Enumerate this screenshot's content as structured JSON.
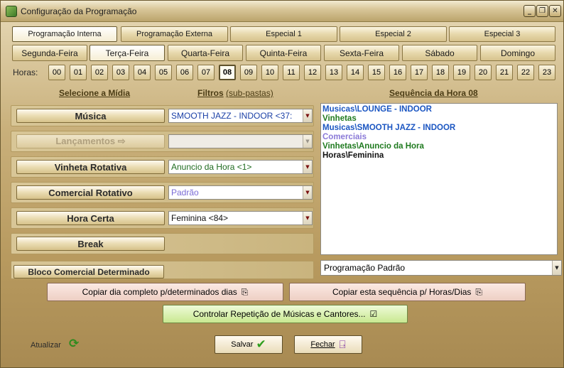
{
  "window": {
    "title": "Configuração da Programação"
  },
  "titlebar": {
    "minimize": "_",
    "restore": "❐",
    "close": "✕"
  },
  "prog_tabs": [
    "Programação Interna",
    "Programação Externa",
    "Especial 1",
    "Especial  2",
    "Especial  3"
  ],
  "day_tabs": [
    "Segunda-Feira",
    "Terça-Feira",
    "Quarta-Feira",
    "Quinta-Feira",
    "Sexta-Feira",
    "Sábado",
    "Domingo"
  ],
  "hours_label": "Horas:",
  "hours": [
    "00",
    "01",
    "02",
    "03",
    "04",
    "05",
    "06",
    "07",
    "08",
    "09",
    "10",
    "11",
    "12",
    "13",
    "14",
    "15",
    "16",
    "17",
    "18",
    "19",
    "20",
    "21",
    "22",
    "23"
  ],
  "selected_hour": "08",
  "headers": {
    "media": "Selecione a Mídia",
    "filters_a": "Filtros",
    "filters_b": "(sub-pastas)",
    "sequence": "Sequência da Hora 08"
  },
  "media_rows": [
    {
      "button": "Música",
      "combo": "SMOOTH JAZZ - INDOOR <37:",
      "combo_color": "#1a3fa6",
      "enabled": true
    },
    {
      "button": "Lançamentos ⇨",
      "combo": "",
      "combo_color": "#000000",
      "enabled": false
    },
    {
      "button": "Vinheta Rotativa",
      "combo": "Anuncio da Hora <1>",
      "combo_color": "#1f6b1f",
      "enabled": true
    },
    {
      "button": "Comercial Rotativo",
      "combo": "Padrão",
      "combo_color": "#7a6bd6",
      "enabled": true
    },
    {
      "button": "Hora Certa",
      "combo": "Feminina <84>",
      "combo_color": "#111111",
      "enabled": true
    },
    {
      "button": "Break",
      "combo": null,
      "combo_color": null,
      "enabled": true
    }
  ],
  "bloco_button": "Bloco Comercial Determinado",
  "sequence": [
    {
      "text": "Musicas\\LOUNGE - INDOOR",
      "color": "#1b56c2"
    },
    {
      "text": "Vinhetas",
      "color": "#1f7a1f"
    },
    {
      "text": "Musicas\\SMOOTH JAZZ - INDOOR",
      "color": "#1b56c2"
    },
    {
      "text": "Comerciais",
      "color": "#8a7ad8"
    },
    {
      "text": "Vinhetas\\Anuncio da Hora",
      "color": "#1f7a1f"
    },
    {
      "text": "Horas\\Feminina",
      "color": "#111111"
    }
  ],
  "program_select": "Programação Padrão",
  "actions": {
    "copy_day": "Copiar dia completo p/determinados dias",
    "copy_seq": "Copiar esta sequência p/  Horas/Dias",
    "control": "Controlar Repetição de Músicas e Cantores...",
    "refresh": "Atualizar",
    "save": "Salvar",
    "close": "Fechar"
  }
}
